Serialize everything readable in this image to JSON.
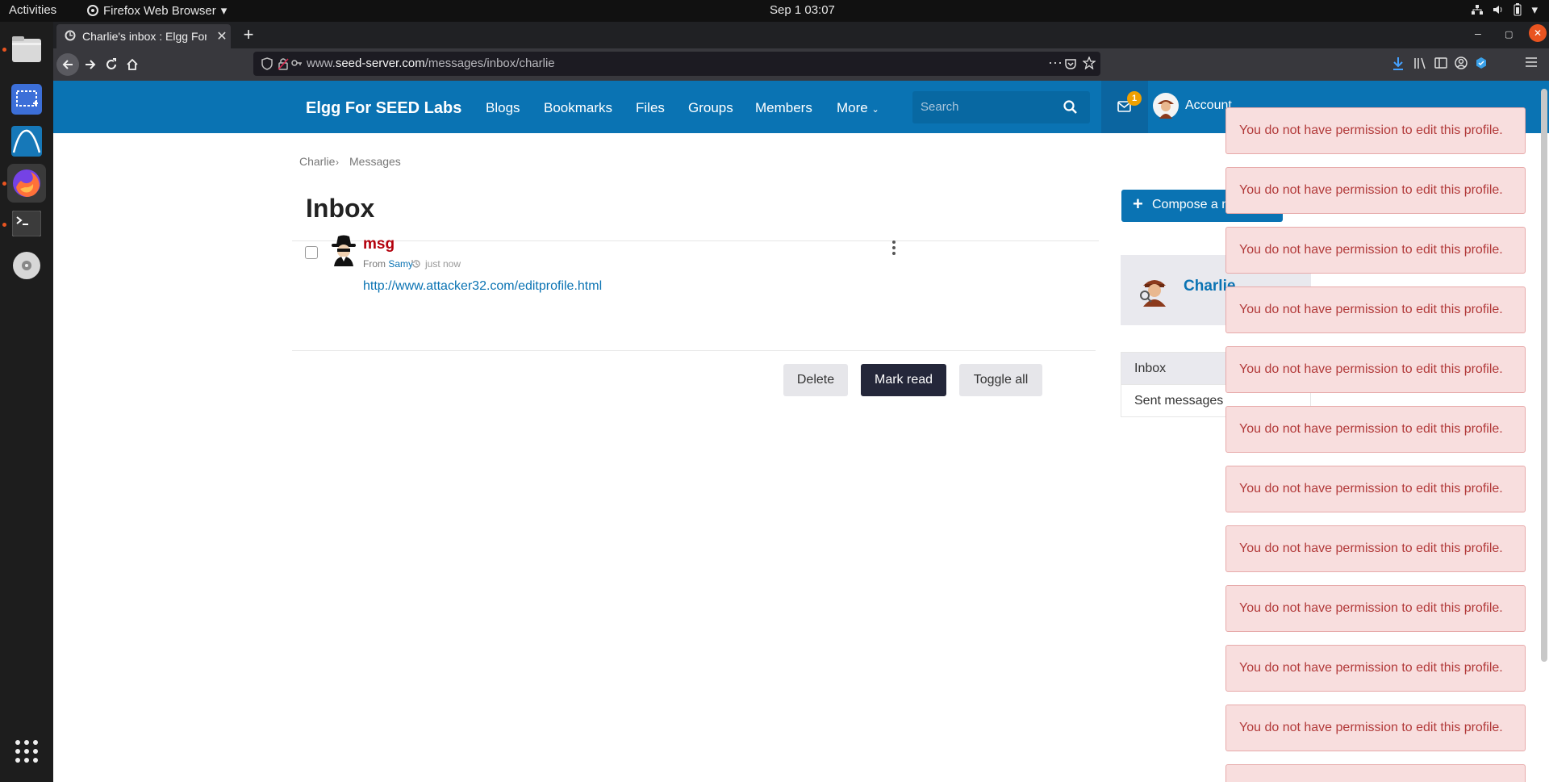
{
  "topbar": {
    "activities": "Activities",
    "app_name": "Firefox Web Browser",
    "clock": "Sep 1  03:07"
  },
  "browser": {
    "tab_title": "Charlie's inbox : Elgg For",
    "url_prefix": "www.",
    "url_host": "seed-server.com",
    "url_path": "/messages/inbox/charlie"
  },
  "site": {
    "brand": "Elgg For SEED Labs",
    "nav": [
      "Blogs",
      "Bookmarks",
      "Files",
      "Groups",
      "Members",
      "More"
    ],
    "search_placeholder": "Search",
    "message_count": "1",
    "account_label": "Account"
  },
  "breadcrumb": [
    "Charlie",
    "Messages"
  ],
  "breadcrumb_separator": "›",
  "page_title": "Inbox",
  "compose_label": "Compose a message",
  "message": {
    "subject": "msg",
    "from_label": "From",
    "sender": "Samy",
    "time": "just now",
    "link": "http://www.attacker32.com/editprofile.html"
  },
  "actions": {
    "delete": "Delete",
    "mark_read": "Mark read",
    "toggle_all": "Toggle all"
  },
  "owner": {
    "name": "Charlie"
  },
  "sidebar": {
    "items": [
      "Inbox",
      "Sent messages"
    ]
  },
  "errors": [
    "You do not have permission to edit this profile.",
    "You do not have permission to edit this profile.",
    "You do not have permission to edit this profile.",
    "You do not have permission to edit this profile.",
    "You do not have permission to edit this profile.",
    "You do not have permission to edit this profile.",
    "You do not have permission to edit this profile.",
    "You do not have permission to edit this profile.",
    "You do not have permission to edit this profile.",
    "You do not have permission to edit this profile.",
    "You do not have permission to edit this profile."
  ],
  "colors": {
    "header": "#0a73b3",
    "subject": "#b3000c",
    "error_bg": "#f8dede",
    "error_text": "#b23a3a"
  }
}
